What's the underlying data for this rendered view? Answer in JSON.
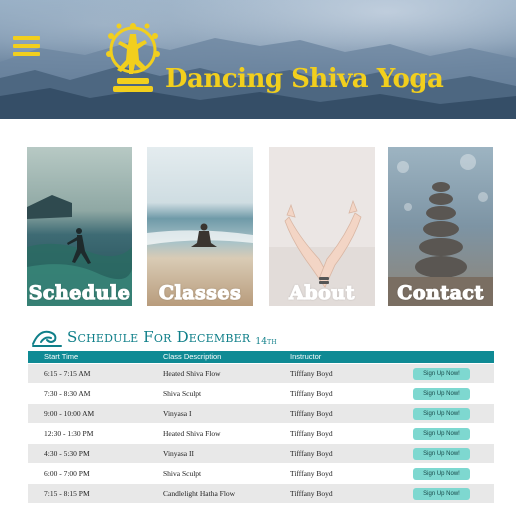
{
  "header": {
    "brand_name": "Dancing Shiva Yoga",
    "menu_icon": "hamburger-menu-icon",
    "logo_icon": "dancing-shiva-logo",
    "brand_color": "#f2cf1d"
  },
  "tiles": [
    {
      "label": "Schedule"
    },
    {
      "label": "Classes"
    },
    {
      "label": "About"
    },
    {
      "label": "Contact"
    }
  ],
  "schedule": {
    "title": "Schedule For December",
    "title_day": "14th",
    "accent_color": "#0f8a94",
    "columns": {
      "time": "Start Time",
      "class": "Class Description",
      "instructor": "Instructor"
    },
    "rows": [
      {
        "time": "6:15 - 7:15 AM",
        "class": "Heated Shiva Flow",
        "instructor": "Tifffany Boyd",
        "action": "Sign Up Now!"
      },
      {
        "time": "7:30 - 8:30 AM",
        "class": "Shiva Sculpt",
        "instructor": "Tifffany Boyd",
        "action": "Sign Up Now!"
      },
      {
        "time": "9:00 - 10:00 AM",
        "class": "Vinyasa I",
        "instructor": "Tifffany Boyd",
        "action": "Sign Up Now!"
      },
      {
        "time": "12:30 - 1:30 PM",
        "class": "Heated Shiva Flow",
        "instructor": "Tifffany Boyd",
        "action": "Sign Up Now!"
      },
      {
        "time": "4:30 - 5:30 PM",
        "class": "Vinyasa II",
        "instructor": "Tifffany Boyd",
        "action": "Sign Up Now!"
      },
      {
        "time": "6:00 - 7:00 PM",
        "class": "Shiva Sculpt",
        "instructor": "Tifffany Boyd",
        "action": "Sign Up Now!"
      },
      {
        "time": "7:15 - 8:15 PM",
        "class": "Candlelight Hatha Flow",
        "instructor": "Tifffany Boyd",
        "action": "Sign Up Now!"
      }
    ]
  }
}
